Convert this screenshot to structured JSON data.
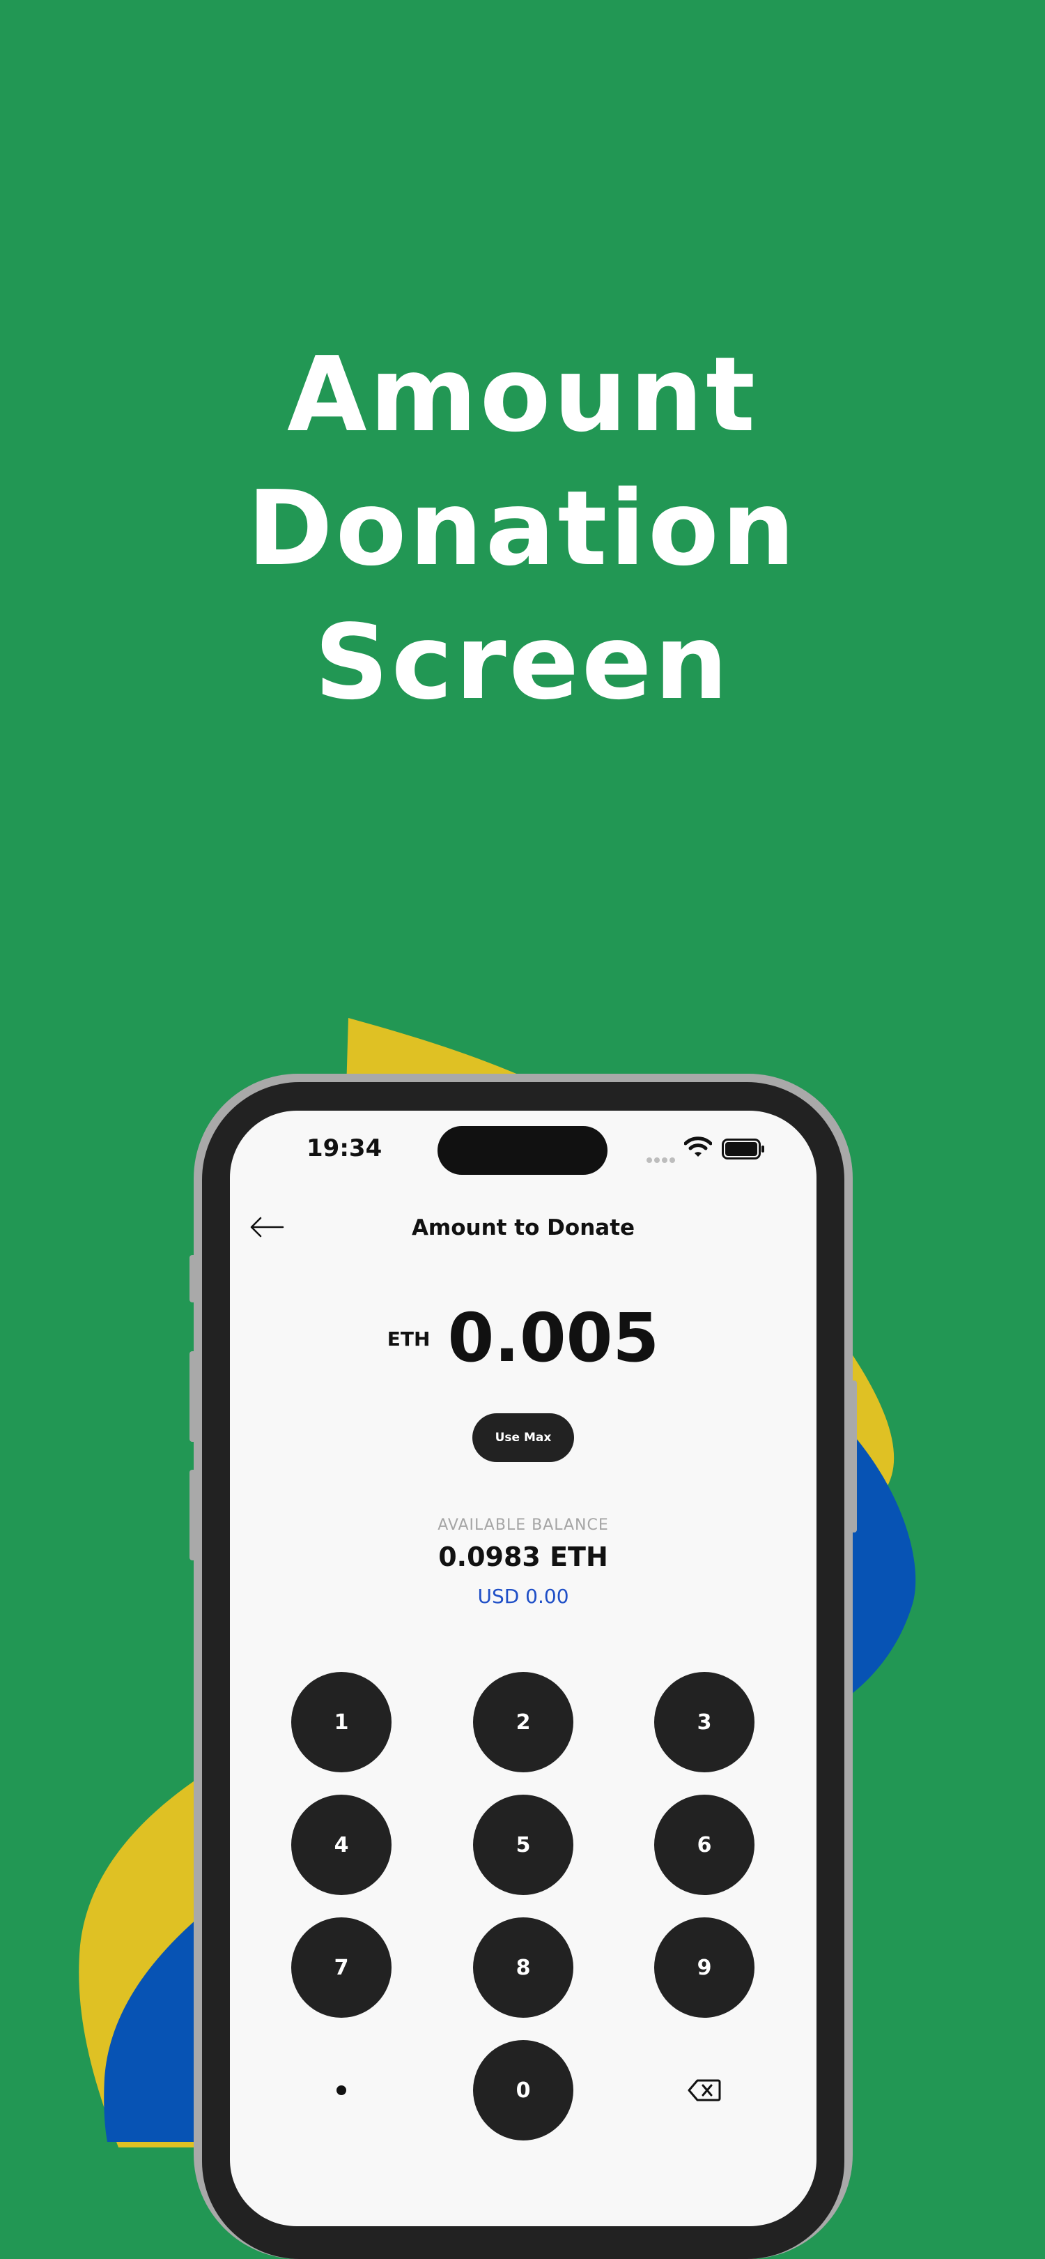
{
  "headline": {
    "line1": "Amount",
    "line2": "Donation",
    "line3": "Screen"
  },
  "colors": {
    "background": "#229754",
    "blob_yellow": "#dfc124",
    "blob_blue": "#0753b4",
    "key_dark": "#222222",
    "fiat_blue": "#1f4fc7"
  },
  "status_bar": {
    "time": "19:34",
    "icons": [
      "signal-dots-icon",
      "wifi-icon",
      "battery-icon"
    ]
  },
  "nav": {
    "back_icon": "arrow-left-icon",
    "title": "Amount to Donate"
  },
  "amount": {
    "currency": "ETH",
    "value": "0.005"
  },
  "use_max_label": "Use Max",
  "balance": {
    "label": "AVAILABLE BALANCE",
    "value": "0.0983 ETH",
    "fiat": "USD 0.00"
  },
  "keypad": {
    "keys": [
      "1",
      "2",
      "3",
      "4",
      "5",
      "6",
      "7",
      "8",
      "9",
      "0"
    ],
    "decimal_icon": "decimal-dot-icon",
    "backspace_icon": "backspace-icon"
  }
}
